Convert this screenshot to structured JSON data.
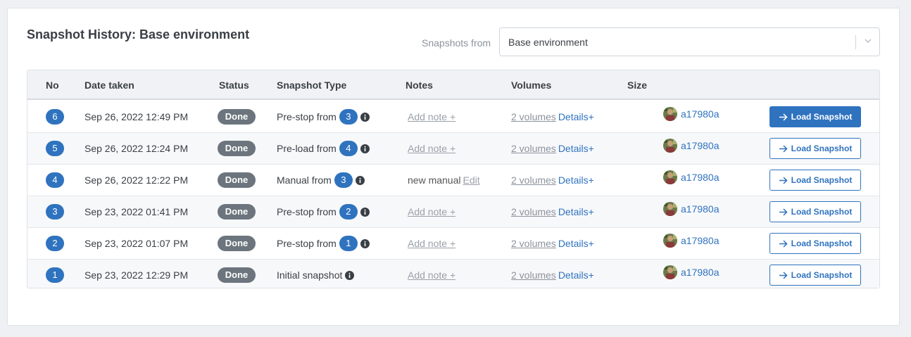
{
  "header": {
    "title": "Snapshot History: Base environment",
    "filter_label": "Snapshots from",
    "filter_value": "Base environment"
  },
  "columns": [
    "No",
    "Date taken",
    "Status",
    "Snapshot Type",
    "Notes",
    "Volumes",
    "Size"
  ],
  "colors": {
    "accent": "#2f73bf",
    "status_done": "#6c757d"
  },
  "rows": [
    {
      "no": "6",
      "date": "Sep 26, 2022 12:49 PM",
      "status": "Done",
      "type": "Pre-stop from",
      "from": "3",
      "note": "Add note +",
      "note_edit": "",
      "volumes": "2 volumes",
      "details": "Details+",
      "author": "a17980a",
      "action": "Load Snapshot",
      "primary": true
    },
    {
      "no": "5",
      "date": "Sep 26, 2022 12:24 PM",
      "status": "Done",
      "type": "Pre-load from",
      "from": "4",
      "note": "Add note +",
      "note_edit": "",
      "volumes": "2 volumes",
      "details": "Details+",
      "author": "a17980a",
      "action": "Load Snapshot",
      "primary": false
    },
    {
      "no": "4",
      "date": "Sep 26, 2022 12:22 PM",
      "status": "Done",
      "type": "Manual from",
      "from": "3",
      "note": "new manual",
      "note_edit": "Edit",
      "volumes": "2 volumes",
      "details": "Details+",
      "author": "a17980a",
      "action": "Load Snapshot",
      "primary": false
    },
    {
      "no": "3",
      "date": "Sep 23, 2022 01:41 PM",
      "status": "Done",
      "type": "Pre-stop from",
      "from": "2",
      "note": "Add note +",
      "note_edit": "",
      "volumes": "2 volumes",
      "details": "Details+",
      "author": "a17980a",
      "action": "Load Snapshot",
      "primary": false
    },
    {
      "no": "2",
      "date": "Sep 23, 2022 01:07 PM",
      "status": "Done",
      "type": "Pre-stop from",
      "from": "1",
      "note": "Add note +",
      "note_edit": "",
      "volumes": "2 volumes",
      "details": "Details+",
      "author": "a17980a",
      "action": "Load Snapshot",
      "primary": false
    },
    {
      "no": "1",
      "date": "Sep 23, 2022 12:29 PM",
      "status": "Done",
      "type": "Initial snapshot",
      "from": "",
      "note": "Add note +",
      "note_edit": "",
      "volumes": "2 volumes",
      "details": "Details+",
      "author": "a17980a",
      "action": "Load Snapshot",
      "primary": false
    }
  ]
}
